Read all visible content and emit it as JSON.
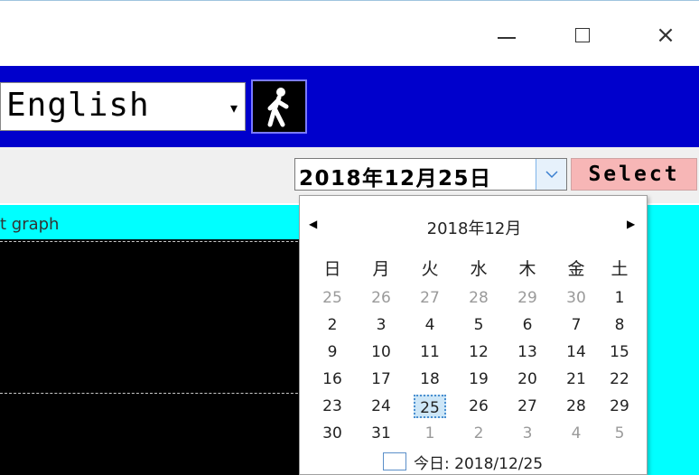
{
  "window": {
    "controls": {
      "minimize": "minimize",
      "maximize": "maximize",
      "close": "×"
    }
  },
  "toolbar": {
    "language_value": "English",
    "language_arrow": "▾",
    "walk_icon": "walking-person-icon"
  },
  "date_picker": {
    "value": "2018年12月25日",
    "select_label": "Select"
  },
  "graph": {
    "label": "t graph"
  },
  "calendar": {
    "month_title": "2018年12月",
    "prev": "◀",
    "next": "▶",
    "weekdays": [
      "日",
      "月",
      "火",
      "水",
      "木",
      "金",
      "土"
    ],
    "weeks": [
      [
        "25",
        "26",
        "27",
        "28",
        "29",
        "30",
        "1"
      ],
      [
        "2",
        "3",
        "4",
        "5",
        "6",
        "7",
        "8"
      ],
      [
        "9",
        "10",
        "11",
        "12",
        "13",
        "14",
        "15"
      ],
      [
        "16",
        "17",
        "18",
        "19",
        "20",
        "21",
        "22"
      ],
      [
        "23",
        "24",
        "25",
        "26",
        "27",
        "28",
        "29"
      ],
      [
        "30",
        "31",
        "1",
        "2",
        "3",
        "4",
        "5"
      ]
    ],
    "other_month": [
      [
        true,
        true,
        true,
        true,
        true,
        true,
        false
      ],
      [
        false,
        false,
        false,
        false,
        false,
        false,
        false
      ],
      [
        false,
        false,
        false,
        false,
        false,
        false,
        false
      ],
      [
        false,
        false,
        false,
        false,
        false,
        false,
        false
      ],
      [
        false,
        false,
        false,
        false,
        false,
        false,
        false
      ],
      [
        false,
        false,
        true,
        true,
        true,
        true,
        true
      ]
    ],
    "today_label": "今日: 2018/12/25"
  },
  "colors": {
    "toolbar_bg": "#0000cc",
    "graph_bg": "#00ffff",
    "select_bg": "#f7b6b6"
  }
}
